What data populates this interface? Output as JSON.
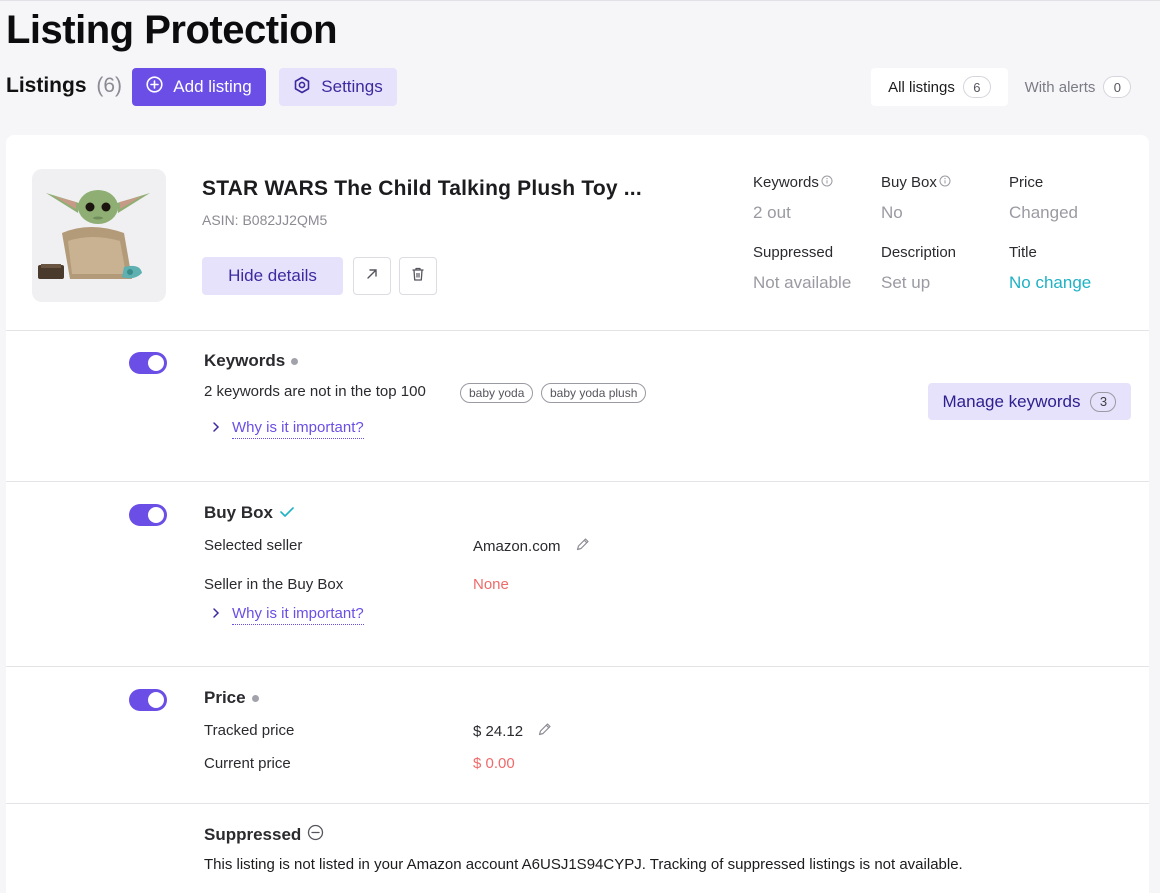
{
  "page": {
    "title": "Listing Protection"
  },
  "listings": {
    "heading": "Listings",
    "count": "(6)",
    "add_label": "Add listing",
    "settings_label": "Settings"
  },
  "filters": {
    "all_label": "All listings",
    "all_count": "6",
    "alerts_label": "With alerts",
    "alerts_count": "0"
  },
  "product": {
    "title": "STAR WARS The Child Talking Plush Toy ...",
    "asin": "ASIN: B082JJ2QM5",
    "hide_label": "Hide details"
  },
  "stats": [
    {
      "label": "Keywords",
      "value": "2 out",
      "info": true,
      "color": "#9a9aa2"
    },
    {
      "label": "Buy Box",
      "value": "No",
      "info": true,
      "color": "#9a9aa2"
    },
    {
      "label": "Price",
      "value": "Changed",
      "info": false,
      "color": "#9a9aa2"
    },
    {
      "label": "Suppressed",
      "value": "Not available",
      "info": false,
      "color": "#9a9aa2"
    },
    {
      "label": "Description",
      "value": "Set up",
      "info": false,
      "color": "#9a9aa2"
    },
    {
      "label": "Title",
      "value": "No change",
      "info": false,
      "color": "#1fb1c4"
    }
  ],
  "keywords_section": {
    "title": "Keywords",
    "status_text": "2 keywords are not in the top 100",
    "tags": [
      "baby yoda",
      "baby yoda plush"
    ],
    "why_label": "Why is it important?",
    "manage_label": "Manage keywords",
    "manage_count": "3",
    "enabled": true
  },
  "buybox_section": {
    "title": "Buy Box",
    "selected_seller_label": "Selected seller",
    "selected_seller_value": "Amazon.com",
    "seller_in_box_label": "Seller in the Buy Box",
    "seller_in_box_value": "None",
    "why_label": "Why is it important?",
    "enabled": true
  },
  "price_section": {
    "title": "Price",
    "tracked_label": "Tracked price",
    "tracked_value": "$ 24.12",
    "current_label": "Current price",
    "current_value": "$ 0.00",
    "enabled": true
  },
  "suppressed_section": {
    "title": "Suppressed",
    "text": "This listing is not listed in your Amazon account A6USJ1S94CYPJ. Tracking of suppressed listings is not available."
  },
  "colors": {
    "accent": "#6b4ee6",
    "accent_soft": "#e6e2fb",
    "teal": "#1fb1c4",
    "alert_red": "#ef6b6b"
  }
}
